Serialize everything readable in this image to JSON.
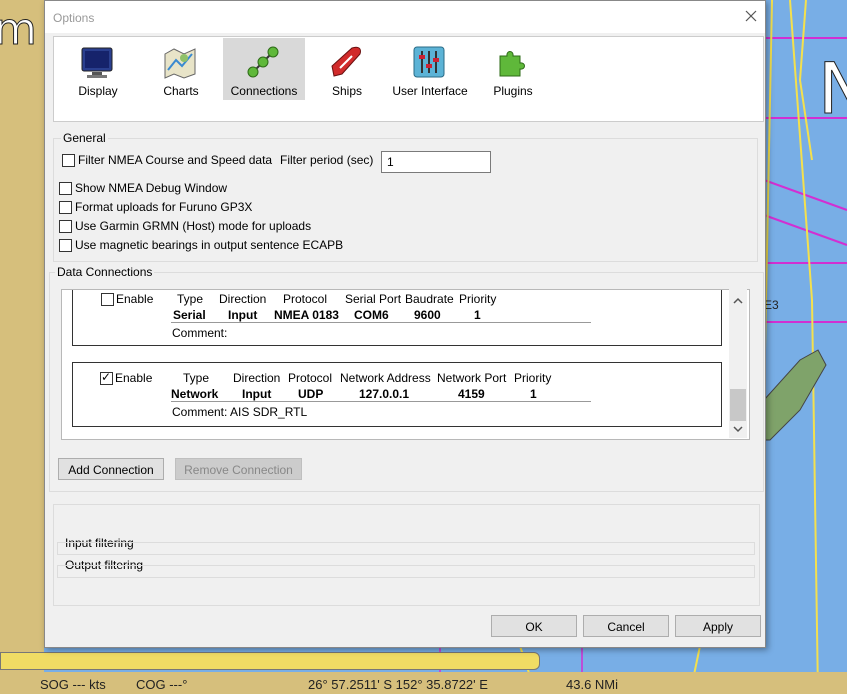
{
  "background_chart": {
    "status": {
      "sog": "SOG --- kts",
      "cog": "COG ---°",
      "position": "26° 57.2511' S   152° 35.8722' E",
      "distance": "43.6 NMi"
    },
    "left_text": "m",
    "right_text": "N",
    "marker_text": "E3"
  },
  "dialog": {
    "title": "Options",
    "tabs": [
      {
        "label": "Display",
        "icon": "display-icon"
      },
      {
        "label": "Charts",
        "icon": "charts-icon"
      },
      {
        "label": "Connections",
        "icon": "connections-icon"
      },
      {
        "label": "Ships",
        "icon": "ships-icon"
      },
      {
        "label": "User Interface",
        "icon": "user-interface-icon"
      },
      {
        "label": "Plugins",
        "icon": "plugins-icon"
      }
    ],
    "active_tab": "Connections",
    "general": {
      "title": "General",
      "filter_nmea": "Filter NMEA Course and Speed data",
      "filter_period_label": "Filter period (sec)",
      "filter_period_value": "1",
      "show_debug": "Show NMEA Debug Window",
      "furuno": "Format uploads for Furuno GP3X",
      "garmin": "Use Garmin GRMN (Host) mode for uploads",
      "magnetic": "Use magnetic bearings in output sentence ECAPB"
    },
    "data_connections": {
      "title": "Data Connections",
      "connections": [
        {
          "enable_label": "Enable",
          "enabled": false,
          "headers": [
            "Type",
            "Direction",
            "Protocol",
            "Serial Port",
            "Baudrate",
            "Priority"
          ],
          "values": [
            "Serial",
            "Input",
            "NMEA 0183",
            "COM6",
            "9600",
            "1"
          ],
          "comment": "Comment:"
        },
        {
          "enable_label": "Enable",
          "enabled": true,
          "headers": [
            "Type",
            "Direction",
            "Protocol",
            "Network Address",
            "Network Port",
            "Priority"
          ],
          "values": [
            "Network",
            "Input",
            "UDP",
            "127.0.0.1",
            "4159",
            "1"
          ],
          "comment": "Comment: AIS SDR_RTL"
        }
      ],
      "add_button": "Add Connection",
      "remove_button": "Remove Connection"
    },
    "filtering": {
      "input": "Input filtering",
      "output": "Output filtering"
    },
    "buttons": {
      "ok": "OK",
      "cancel": "Cancel",
      "apply": "Apply"
    }
  }
}
